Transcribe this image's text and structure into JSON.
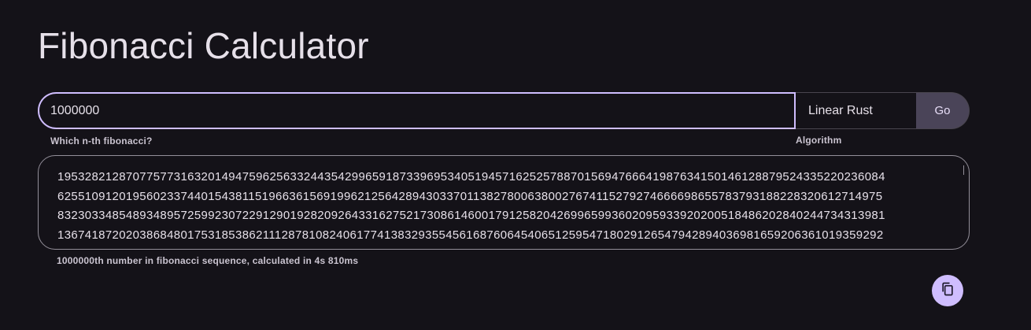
{
  "header": {
    "title": "Fibonacci Calculator"
  },
  "form": {
    "n_input_value": "1000000",
    "n_input_helper": "Which n-th fibonacci?",
    "algorithm_selected": "Linear Rust",
    "algorithm_helper": "Algorithm",
    "go_label": "Go"
  },
  "result": {
    "lines": [
      "1953282128707757731632014947596256332443542996591873396953405194571625257887015694766641987634150146128879524335220236084",
      "6255109120195602337440154381151966361569199621256428943033701138278006380027674115279274666698655783793188228320612714975",
      "8323033485489348957259923072291290192820926433162752173086146001791258204269965993602095933920200518486202840244734313981",
      "1367418720203868480175318538621112878108240617741383293554561687606454065125954718029126547942894036981659206361019359292"
    ],
    "caption": "1000000th number in fibonacci sequence, calculated in 4s 810ms"
  },
  "icons": {
    "copy": "copy-icon"
  },
  "colors": {
    "background": "#141218",
    "primary": "#cfbdfe",
    "button_bg": "#4a4458",
    "outline": "#938f99",
    "text": "#e6e0e9"
  }
}
